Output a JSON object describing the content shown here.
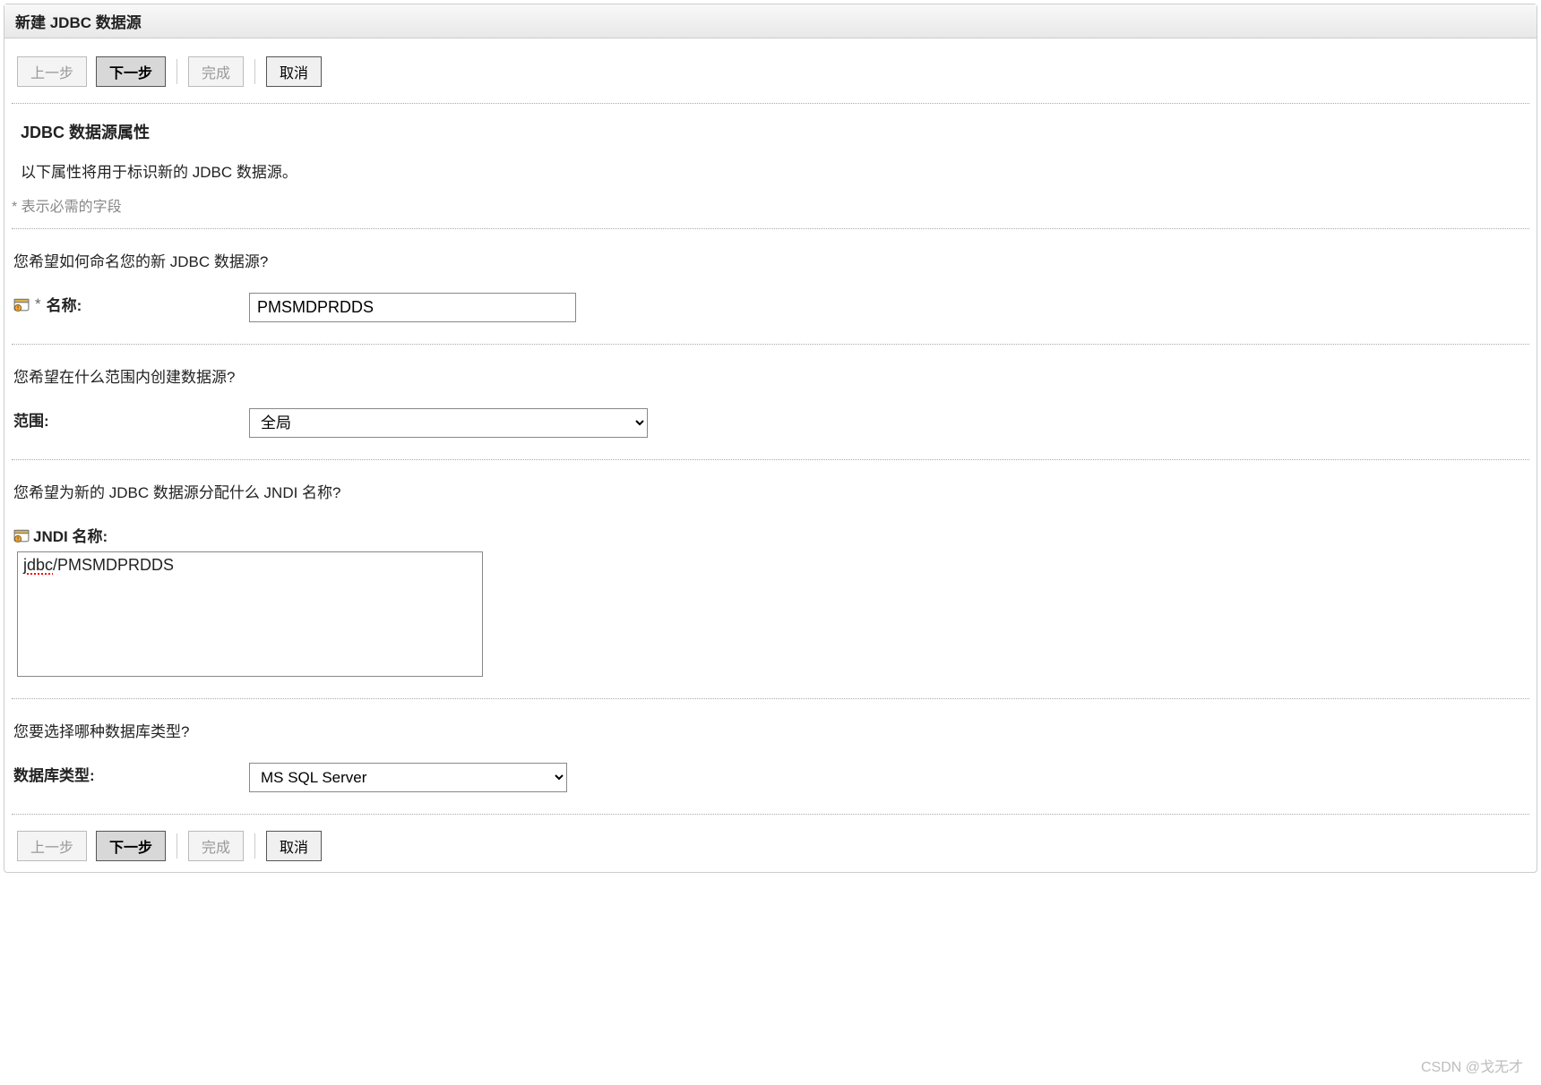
{
  "panel": {
    "title": "新建 JDBC 数据源"
  },
  "buttons": {
    "back": "上一步",
    "next": "下一步",
    "finish": "完成",
    "cancel": "取消"
  },
  "props": {
    "heading": "JDBC 数据源属性",
    "desc": "以下属性将用于标识新的 JDBC 数据源。",
    "required_note": "* 表示必需的字段"
  },
  "name_block": {
    "question": "您希望如何命名您的新 JDBC 数据源?",
    "label": "名称:",
    "value": "PMSMDPRDDS"
  },
  "scope_block": {
    "question": "您希望在什么范围内创建数据源?",
    "label": "范围:",
    "value": "全局"
  },
  "jndi_block": {
    "question": "您希望为新的 JDBC 数据源分配什么 JNDI 名称?",
    "label": "JNDI 名称:",
    "prefix_bad": "jdbc",
    "rest": "/PMSMDPRDDS"
  },
  "db_block": {
    "question": "您要选择哪种数据库类型?",
    "label": "数据库类型:",
    "value": "MS SQL Server"
  },
  "watermark": "CSDN @戈无才"
}
